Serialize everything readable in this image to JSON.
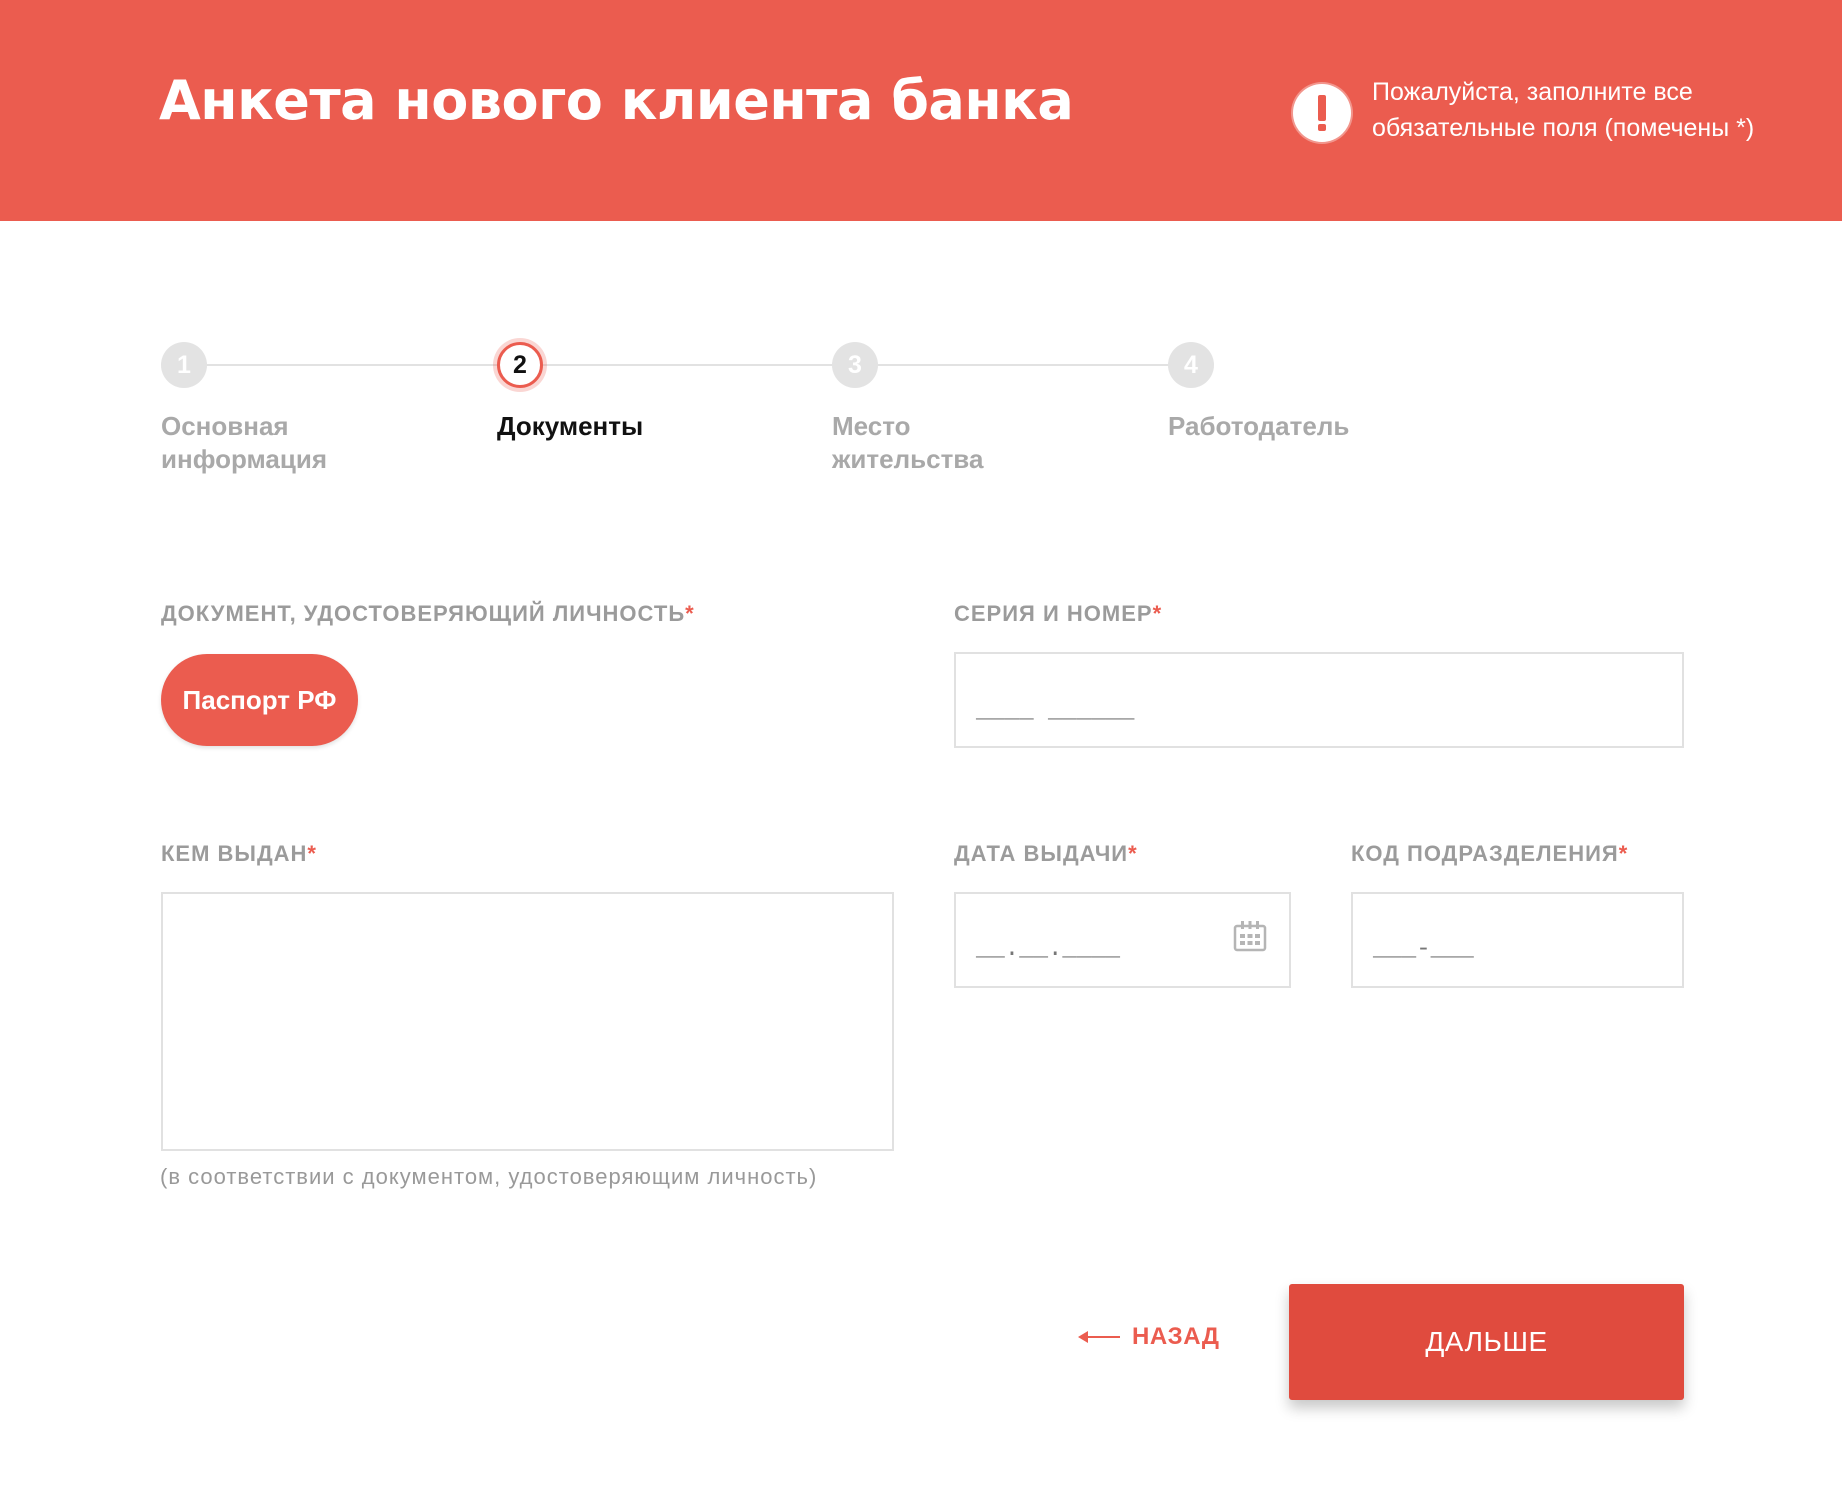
{
  "header": {
    "title": "Анкета нового клиента банка",
    "alert_text": "Пожалуйста, заполните все обязательные поля (помечены *)",
    "accent_color": "#EB5C4F"
  },
  "stepper": {
    "current": 2,
    "steps": [
      {
        "number": "1",
        "label": "Основная информация"
      },
      {
        "number": "2",
        "label": "Документы"
      },
      {
        "number": "3",
        "label": "Место жительства"
      },
      {
        "number": "4",
        "label": "Работодатель"
      }
    ]
  },
  "form": {
    "document": {
      "label": "ДОКУМЕНТ, УДОСТОВЕРЯЮЩИЙ ЛИЧНОСТЬ",
      "selected": "Паспорт РФ"
    },
    "series_number": {
      "label": "СЕРИЯ И НОМЕР",
      "mask": "____ ______"
    },
    "issued_by": {
      "label": "КЕМ ВЫДАН",
      "value": "",
      "hint": "(в соответствии с документом, удостоверяющим личность)"
    },
    "issue_date": {
      "label": "ДАТА ВЫДАЧИ",
      "mask": "__.__.____"
    },
    "division_code": {
      "label": "КОД ПОДРАЗДЕЛЕНИЯ",
      "mask": "___-___"
    },
    "required_mark": "*"
  },
  "actions": {
    "back_label": "НАЗАД",
    "next_label": "ДАЛЬШЕ"
  },
  "icons": [
    "exclamation-icon",
    "calendar-icon",
    "arrow-left-icon"
  ]
}
